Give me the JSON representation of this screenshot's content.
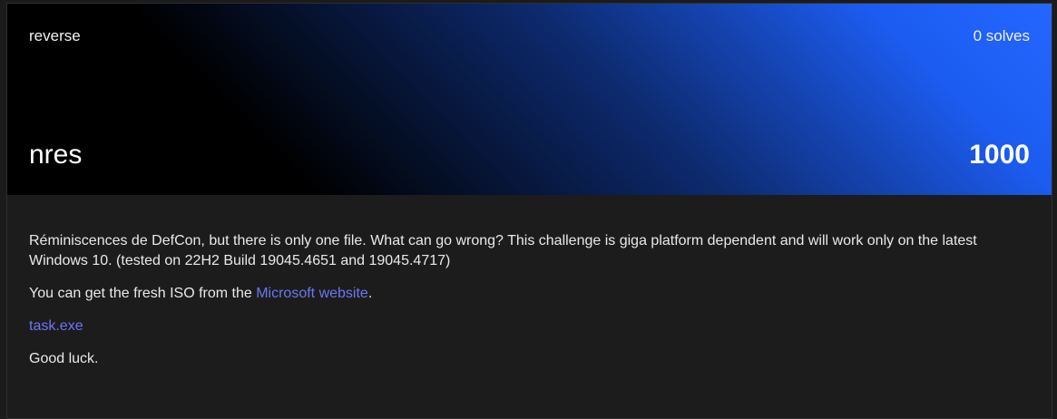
{
  "challenge": {
    "category": "reverse",
    "solves": "0 solves",
    "name": "nres",
    "points": "1000"
  },
  "description": {
    "paragraph1": "Réminiscences de DefCon, but there is only one file. What can go wrong? This challenge is giga platform dependent and will work only on the latest Windows 10. (tested on 22H2 Build 19045.4651 and 19045.4717)",
    "paragraph2_prefix": "You can get the fresh ISO from the ",
    "paragraph2_link": "Microsoft website",
    "paragraph2_suffix": ".",
    "file_link": "task.exe",
    "closing": "Good luck."
  },
  "colors": {
    "background": "#1c1c1c",
    "gradient_end": "#2466ff",
    "link": "#6a78f2"
  }
}
